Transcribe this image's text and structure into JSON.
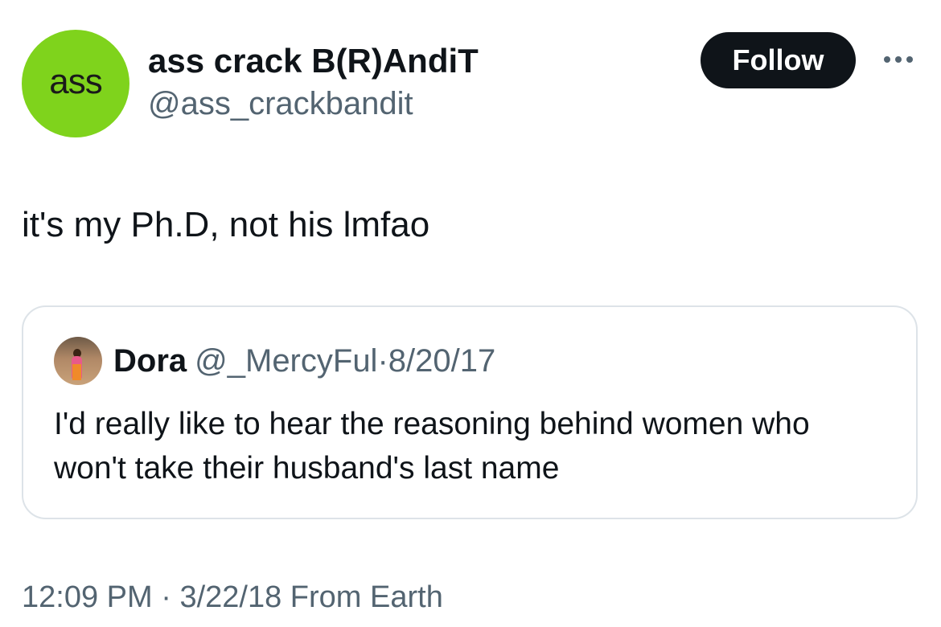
{
  "author": {
    "avatar_text": "ass",
    "display_name": "ass crack B(R)AndiT",
    "handle": "@ass_crackbandit"
  },
  "actions": {
    "follow_label": "Follow",
    "more_icon": "more-horizontal-icon"
  },
  "tweet": {
    "text": "it's my Ph.D, not his lmfao"
  },
  "quoted_tweet": {
    "name": "Dora",
    "handle": "@_MercyFul",
    "separator": "·",
    "date": "8/20/17",
    "text": "I'd really like to hear the reasoning behind women who won't take their husband's last name"
  },
  "footer": {
    "time": "12:09 PM",
    "separator": "·",
    "date": "3/22/18",
    "source": "From Earth"
  },
  "colors": {
    "avatar_green": "#7fd31c",
    "follow_bg": "#0f1419",
    "secondary_text": "#536471",
    "border": "#dde3e8"
  }
}
